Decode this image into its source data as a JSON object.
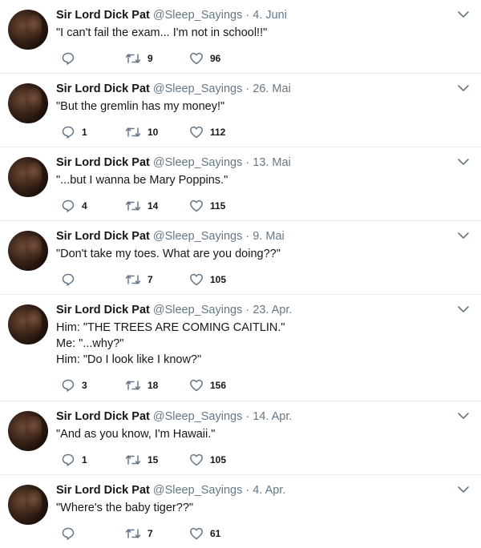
{
  "tweets": [
    {
      "name": "Sir Lord Dick Pat",
      "handle": "@Sleep_Sayings",
      "sep": "·",
      "date": "4. Juni",
      "lines": [
        "\"I can't fail the exam... I'm not in school!!\""
      ],
      "replies": "",
      "retweets": "9",
      "likes": "96"
    },
    {
      "name": "Sir Lord Dick Pat",
      "handle": "@Sleep_Sayings",
      "sep": "·",
      "date": "26. Mai",
      "lines": [
        "\"But the gremlin has my money!\""
      ],
      "replies": "1",
      "retweets": "10",
      "likes": "112"
    },
    {
      "name": "Sir Lord Dick Pat",
      "handle": "@Sleep_Sayings",
      "sep": "·",
      "date": "13. Mai",
      "lines": [
        "\"...but I wanna be Mary Poppins.\""
      ],
      "replies": "4",
      "retweets": "14",
      "likes": "115"
    },
    {
      "name": "Sir Lord Dick Pat",
      "handle": "@Sleep_Sayings",
      "sep": "·",
      "date": "9. Mai",
      "lines": [
        "\"Don't take my toes. What are you doing??\""
      ],
      "replies": "",
      "retweets": "7",
      "likes": "105"
    },
    {
      "name": "Sir Lord Dick Pat",
      "handle": "@Sleep_Sayings",
      "sep": "·",
      "date": "23. Apr.",
      "lines": [
        "Him: \"THE TREES ARE COMING CAITLIN.\"",
        "Me: \"...why?\"",
        "Him: \"Do I look like I know?\""
      ],
      "replies": "3",
      "retweets": "18",
      "likes": "156"
    },
    {
      "name": "Sir Lord Dick Pat",
      "handle": "@Sleep_Sayings",
      "sep": "·",
      "date": "14. Apr.",
      "lines": [
        "\"And as you know, I'm Hawaii.\""
      ],
      "replies": "1",
      "retweets": "15",
      "likes": "105"
    },
    {
      "name": "Sir Lord Dick Pat",
      "handle": "@Sleep_Sayings",
      "sep": "·",
      "date": "4. Apr.",
      "lines": [
        "\"Where's the baby tiger??\""
      ],
      "replies": "",
      "retweets": "7",
      "likes": "61"
    }
  ],
  "icons": {
    "reply": "reply-icon",
    "retweet": "retweet-icon",
    "like": "heart-icon",
    "more": "chevron-down-icon"
  },
  "colors": {
    "name": "#14171a",
    "secondary": "#657786",
    "divider": "#e6ecf0"
  }
}
